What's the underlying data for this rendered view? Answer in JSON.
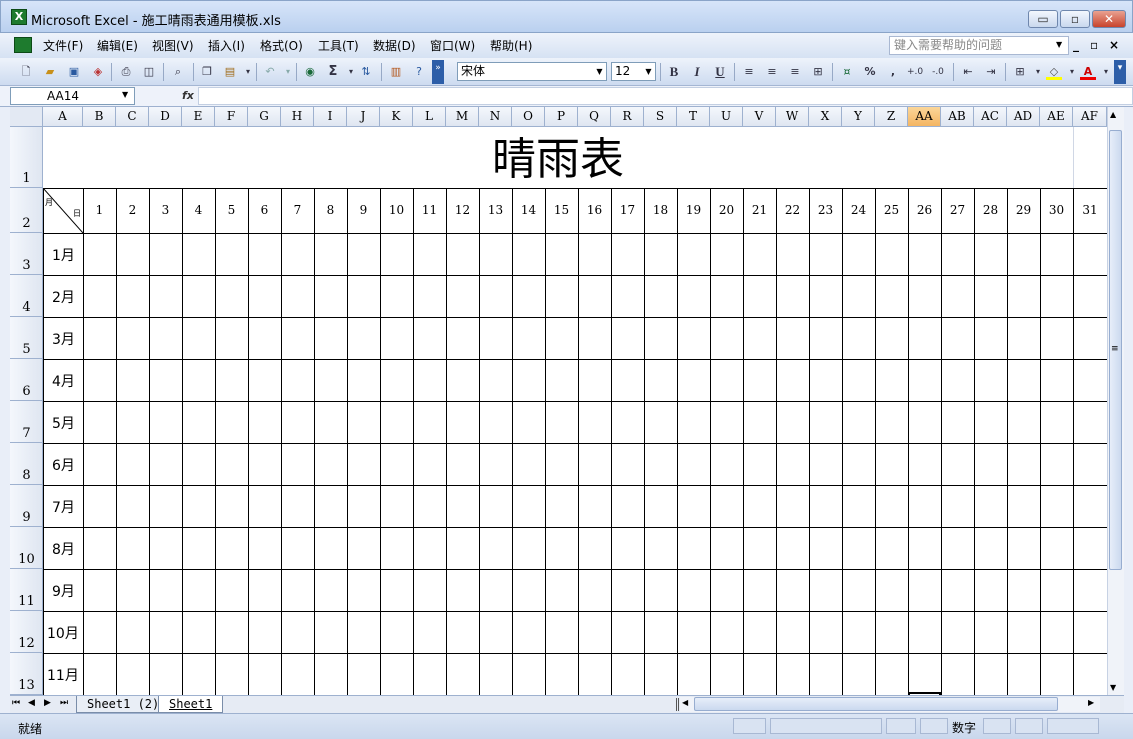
{
  "window": {
    "icon": "X",
    "title": "Microsoft Excel - 施工晴雨表通用模板.xls",
    "minimize": "▭",
    "restore": "▫",
    "close": "✕"
  },
  "menubar": {
    "items": [
      "文件(F)",
      "编辑(E)",
      "视图(V)",
      "插入(I)",
      "格式(O)",
      "工具(T)",
      "数据(D)",
      "窗口(W)",
      "帮助(H)"
    ],
    "help_placeholder": "键入需要帮助的问题",
    "mdi_min": "_",
    "mdi_restore": "▫",
    "mdi_close": "×"
  },
  "toolbar": {
    "font": "宋体",
    "size": "12",
    "bold": "B",
    "italic": "I",
    "underline": "U",
    "sum": "Σ",
    "percent": "%",
    "comma": ","
  },
  "formula_bar": {
    "name_box": "AA14",
    "fx": "fx",
    "value": ""
  },
  "columns": [
    "A",
    "B",
    "C",
    "D",
    "E",
    "F",
    "G",
    "H",
    "I",
    "J",
    "K",
    "L",
    "M",
    "N",
    "O",
    "P",
    "Q",
    "R",
    "S",
    "T",
    "U",
    "V",
    "W",
    "X",
    "Y",
    "Z",
    "AA",
    "AB",
    "AC",
    "AD",
    "AE",
    "AF"
  ],
  "selected_column": "AA",
  "rows": [
    "1",
    "2",
    "3",
    "4",
    "5",
    "6",
    "7",
    "8",
    "9",
    "10",
    "11",
    "12",
    "13"
  ],
  "sheet": {
    "title": "晴雨表",
    "corner_month": "月",
    "corner_day": "日",
    "days": [
      "1",
      "2",
      "3",
      "4",
      "5",
      "6",
      "7",
      "8",
      "9",
      "10",
      "11",
      "12",
      "13",
      "14",
      "15",
      "16",
      "17",
      "18",
      "19",
      "20",
      "21",
      "22",
      "23",
      "24",
      "25",
      "26",
      "27",
      "28",
      "29",
      "30",
      "31"
    ],
    "months": [
      "1月",
      "2月",
      "3月",
      "4月",
      "5月",
      "6月",
      "7月",
      "8月",
      "9月",
      "10月",
      "11月"
    ]
  },
  "tabs": {
    "nav": [
      "⏮",
      "◀",
      "▶",
      "⏭"
    ],
    "sheets": [
      "Sheet1 (2)",
      "Sheet1"
    ],
    "active": "Sheet1"
  },
  "status": {
    "ready": "就绪",
    "num": "数字"
  }
}
